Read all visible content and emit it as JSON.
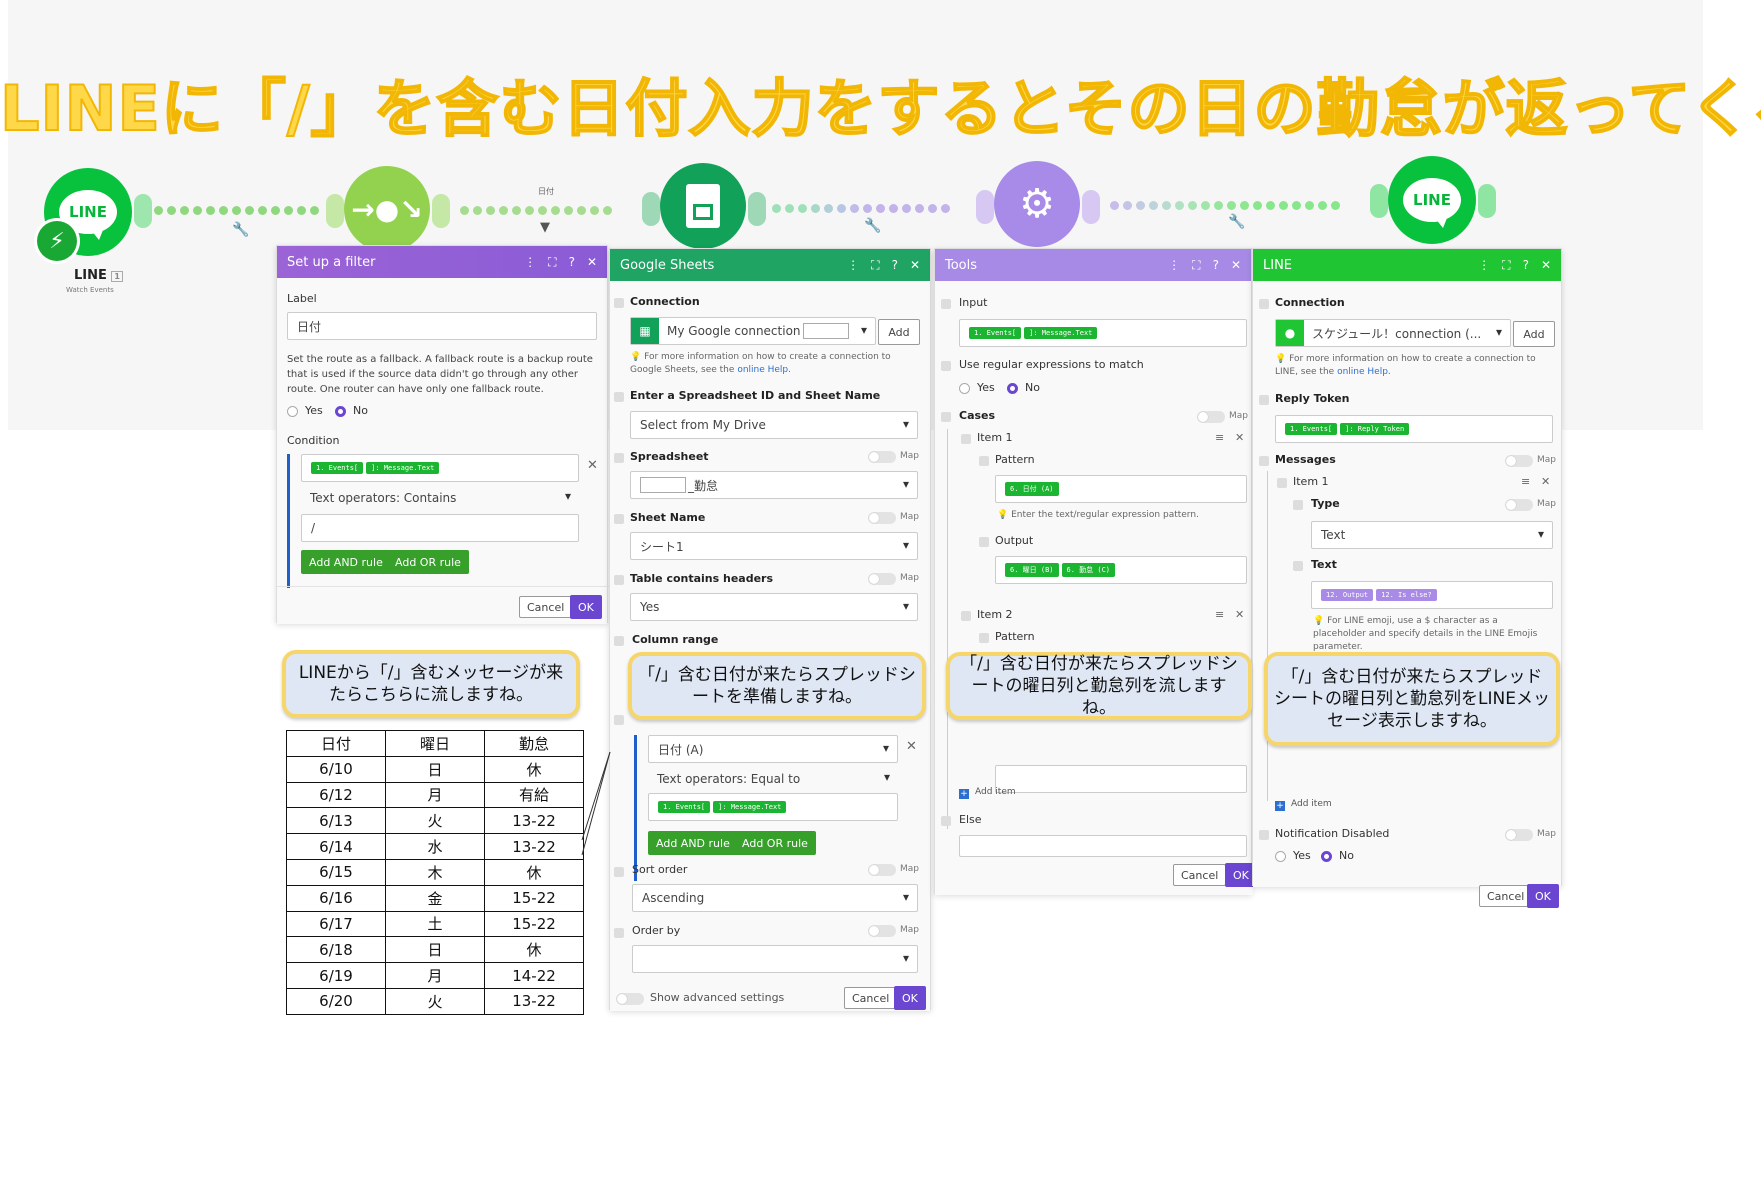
{
  "headline": "LINEに「/」を含む日付入力をするとその日の勤怠が返ってくる",
  "colors": {
    "line_green": "#06c755",
    "router_green": "#8fd14f",
    "sheets_green": "#0f9d58",
    "tools_purple": "#a68ae6",
    "ok_purple": "#6a46d1",
    "headline_yellow": "#ffd84a"
  },
  "flow": {
    "line_trigger": {
      "icon": "LINE",
      "label": "LINE",
      "badge": "1",
      "sub": "Watch Events"
    },
    "router_label": "日付",
    "line_action_icon": "LINE"
  },
  "filter_panel": {
    "title": "Set up a filter",
    "label_caption": "Label",
    "label_value": "日付",
    "fallback_text": "Set the route as a fallback. A fallback route is a backup route that is used if the source data didn't go through any other route. One router can have only one fallback route.",
    "yes": "Yes",
    "no": "No",
    "condition_caption": "Condition",
    "pill1": "1. Events[",
    "pill2": "]: Message.Text",
    "operator": "Text operators: Contains",
    "value": "/",
    "add_and": "Add AND rule",
    "add_or": "Add OR rule",
    "cancel": "Cancel",
    "ok": "OK"
  },
  "sheets_panel": {
    "title": "Google Sheets",
    "connection_caption": "Connection",
    "connection_value": "My Google connection",
    "add": "Add",
    "connection_hint": "For more information on how to create a connection to Google Sheets, see the",
    "online_help": "online Help.",
    "spreadsheet_id_caption": "Enter a Spreadsheet ID and Sheet Name",
    "spreadsheet_id_value": "Select from My Drive",
    "spreadsheet_caption": "Spreadsheet",
    "spreadsheet_value": "_勤怠",
    "sheet_name_caption": "Sheet Name",
    "sheet_name_value": "シート1",
    "headers_caption": "Table contains headers",
    "headers_value": "Yes",
    "column_range_caption": "Column range",
    "filter_column": "日付 (A)",
    "filter_operator": "Text operators: Equal to",
    "pill1": "1. Events[",
    "pill2": "]: Message.Text",
    "add_and": "Add AND rule",
    "add_or": "Add OR rule",
    "sort_caption": "Sort order",
    "sort_value": "Ascending",
    "order_by_caption": "Order by",
    "order_by_value": "",
    "advanced": "Show advanced settings",
    "map": "Map",
    "cancel": "Cancel",
    "ok": "OK"
  },
  "tools_panel": {
    "title": "Tools",
    "input_caption": "Input",
    "pill1": "1. Events[",
    "pill2": "]: Message.Text",
    "regex_caption": "Use regular expressions to match",
    "yes": "Yes",
    "no": "No",
    "cases_caption": "Cases",
    "item1": "Item 1",
    "pattern_caption": "Pattern",
    "pattern_pill": "6. 日付 (A)",
    "pattern_hint": "Enter the text/regular expression pattern.",
    "output_caption": "Output",
    "output_pill1": "6. 曜日 (B)",
    "output_pill2": "6. 勤怠 (C)",
    "item2": "Item 2",
    "pattern2_caption": "Pattern",
    "add_item": "Add item",
    "else_caption": "Else",
    "map": "Map",
    "cancel": "Cancel",
    "ok": "OK"
  },
  "line_panel": {
    "title": "LINE",
    "connection_caption": "Connection",
    "connection_value": "スケジュール！connection (...",
    "add": "Add",
    "connection_hint": "For more information on how to create a connection to LINE, see the",
    "online_help": "online Help.",
    "reply_token_caption": "Reply Token",
    "rt_pill1": "1. Events[",
    "rt_pill2": "]: Reply Token",
    "messages_caption": "Messages",
    "item1": "Item 1",
    "type_caption": "Type",
    "type_value": "Text",
    "text_caption": "Text",
    "text_pill1": "12. Output",
    "text_pill2": "12. Is else?",
    "text_hint": "For LINE emoji, use a $ character as a placeholder and specify details in the LINE Emojis parameter.",
    "add_item": "Add item",
    "notif_caption": "Notification Disabled",
    "yes": "Yes",
    "no": "No",
    "map": "Map",
    "cancel": "Cancel",
    "ok": "OK"
  },
  "callouts": {
    "c1": "LINEから「/」含むメッセージが来たらこちらに流しますね。",
    "c2": "「/」含む日付が来たらスプレッドシートを準備しますね。",
    "c3": "「/」含む日付が来たらスプレッドシートの曜日列と勤怠列を流しますね。",
    "c4": "「/」含む日付が来たらスプレッドシートの曜日列と勤怠列をLINEメッセージ表示しますね。"
  },
  "table": {
    "headers": [
      "日付",
      "曜日",
      "勤怠"
    ],
    "rows": [
      [
        "6/10",
        "日",
        "休"
      ],
      [
        "6/12",
        "月",
        "有給"
      ],
      [
        "6/13",
        "火",
        "13-22"
      ],
      [
        "6/14",
        "水",
        "13-22"
      ],
      [
        "6/15",
        "木",
        "休"
      ],
      [
        "6/16",
        "金",
        "15-22"
      ],
      [
        "6/17",
        "土",
        "15-22"
      ],
      [
        "6/18",
        "日",
        "休"
      ],
      [
        "6/19",
        "月",
        "14-22"
      ],
      [
        "6/20",
        "火",
        "13-22"
      ]
    ]
  }
}
